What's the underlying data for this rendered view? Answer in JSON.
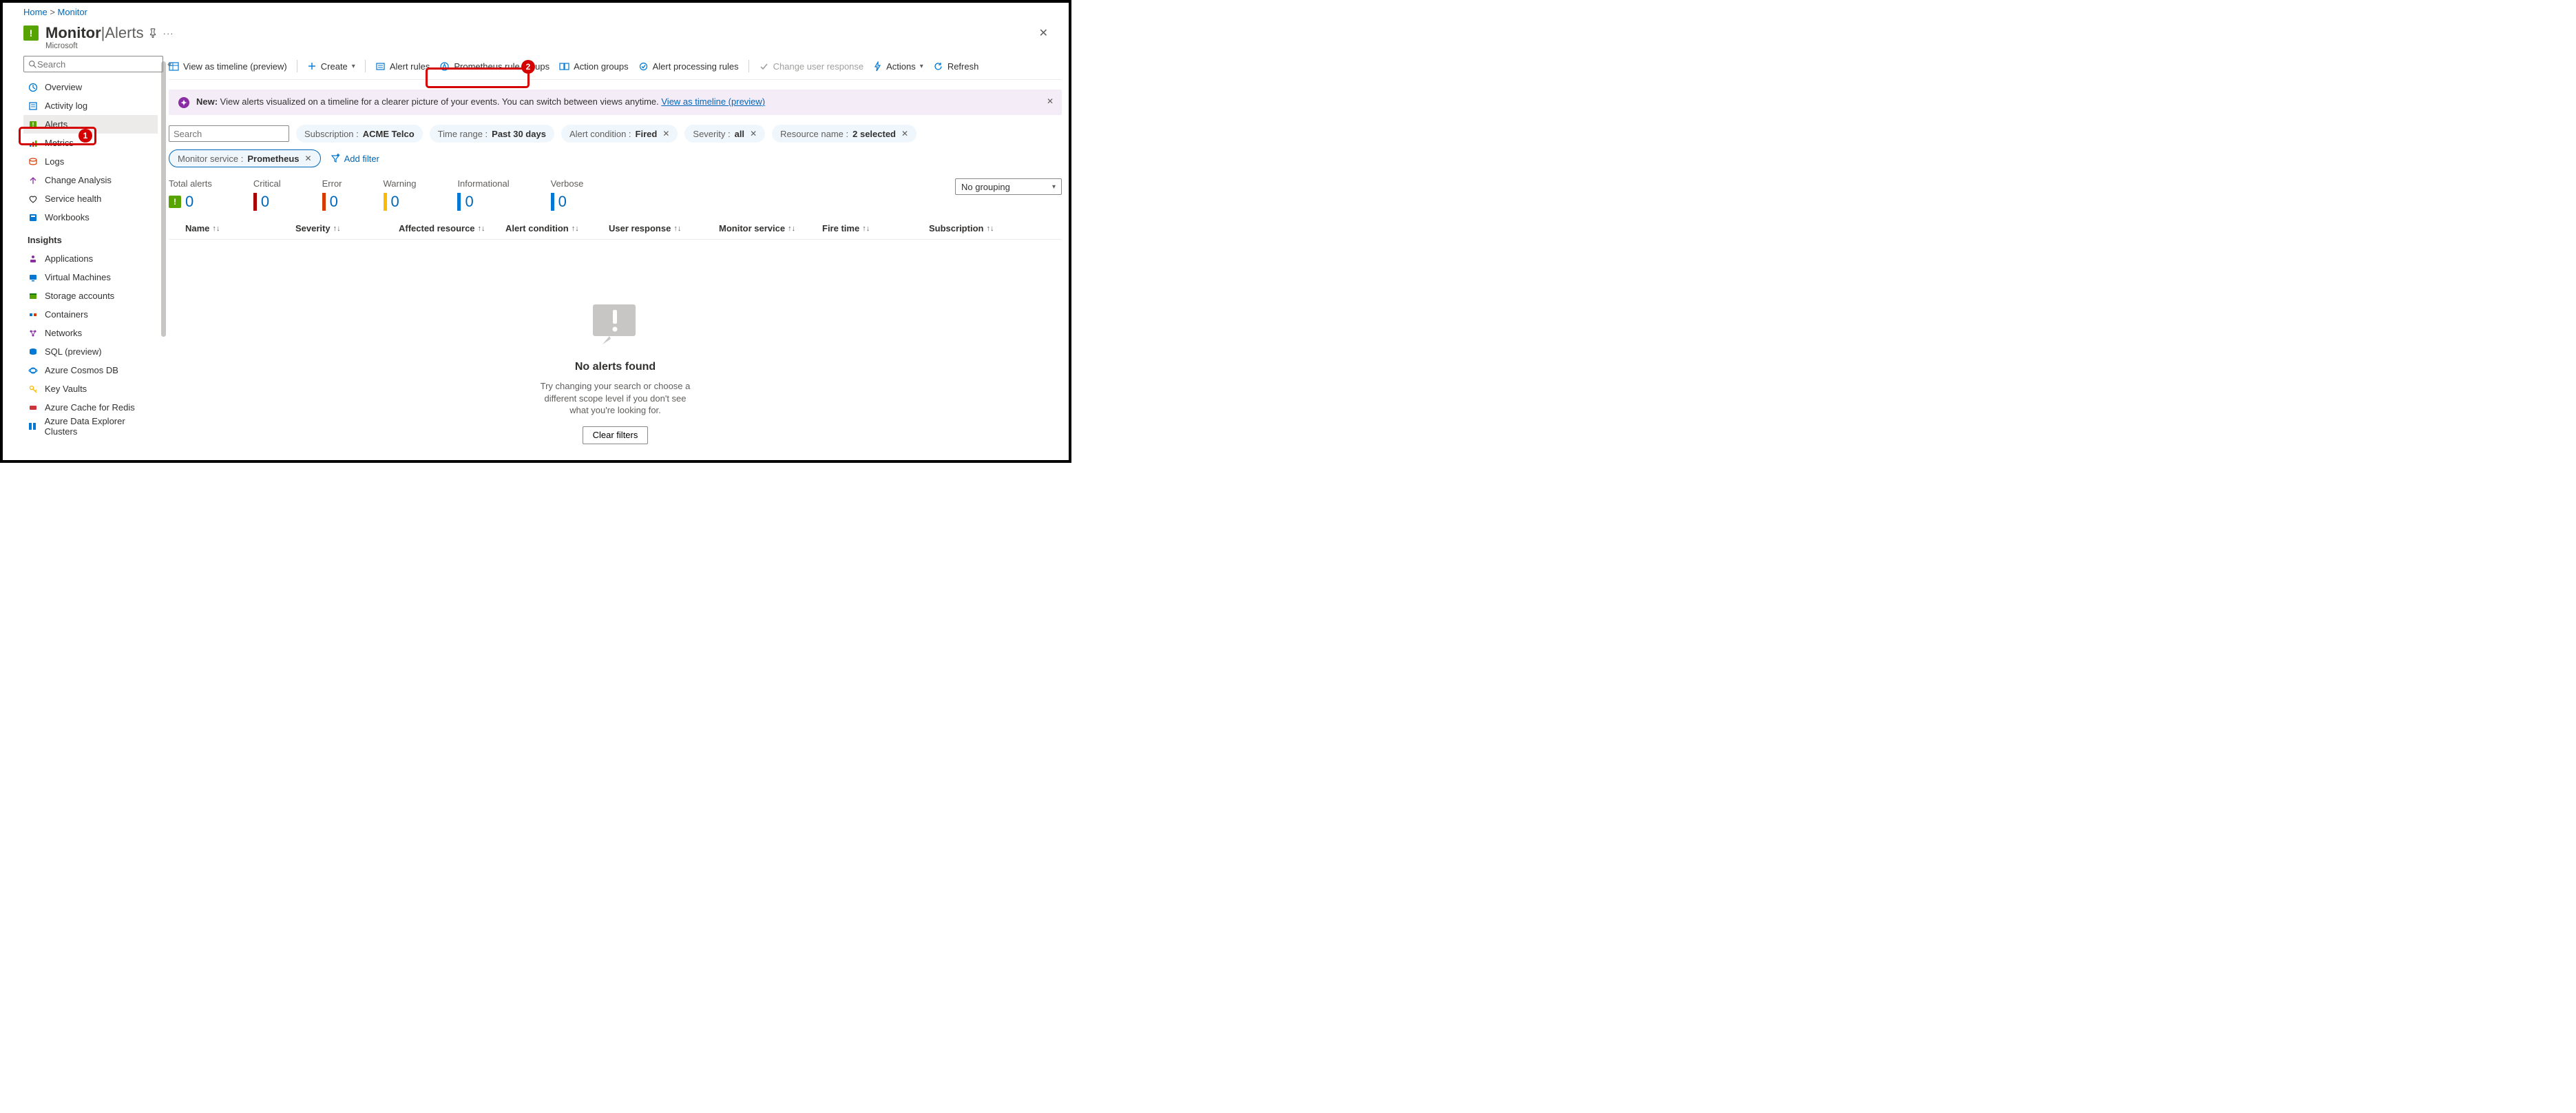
{
  "breadcrumb": {
    "home": "Home",
    "monitor": "Monitor"
  },
  "header": {
    "title_main": "Monitor",
    "title_sep": " | ",
    "title_sub": "Alerts",
    "subtitle": "Microsoft"
  },
  "sidebar": {
    "search": {
      "placeholder": "Search"
    },
    "items": [
      {
        "label": "Overview"
      },
      {
        "label": "Activity log"
      },
      {
        "label": "Alerts"
      },
      {
        "label": "Metrics"
      },
      {
        "label": "Logs"
      },
      {
        "label": "Change Analysis"
      },
      {
        "label": "Service health"
      },
      {
        "label": "Workbooks"
      }
    ],
    "insights_head": "Insights",
    "insights": [
      {
        "label": "Applications"
      },
      {
        "label": "Virtual Machines"
      },
      {
        "label": "Storage accounts"
      },
      {
        "label": "Containers"
      },
      {
        "label": "Networks"
      },
      {
        "label": "SQL (preview)"
      },
      {
        "label": "Azure Cosmos DB"
      },
      {
        "label": "Key Vaults"
      },
      {
        "label": "Azure Cache for Redis"
      },
      {
        "label": "Azure Data Explorer Clusters"
      }
    ]
  },
  "toolbar": {
    "view_timeline": "View as timeline (preview)",
    "create": "Create",
    "alert_rules": "Alert rules",
    "prometheus": "Prometheus rule groups",
    "action_groups": "Action groups",
    "processing": "Alert processing rules",
    "change_resp": "Change user response",
    "actions": "Actions",
    "refresh": "Refresh"
  },
  "banner": {
    "new": "New:",
    "text": " View alerts visualized on a timeline for a clearer picture of your events. You can switch between views anytime. ",
    "link": "View as timeline (preview)"
  },
  "search2": {
    "placeholder": "Search"
  },
  "filters": [
    {
      "k": "Subscription : ",
      "v": "ACME Telco",
      "x": false
    },
    {
      "k": "Time range : ",
      "v": "Past 30 days",
      "x": false
    },
    {
      "k": "Alert condition : ",
      "v": "Fired",
      "x": true
    },
    {
      "k": "Severity : ",
      "v": "all",
      "x": true
    },
    {
      "k": "Resource name : ",
      "v": "2 selected",
      "x": true
    },
    {
      "k": "Monitor service : ",
      "v": "Prometheus",
      "x": true,
      "selected": true
    }
  ],
  "add_filter": "Add filter",
  "metrics": [
    {
      "label": "Total alerts",
      "val": "0",
      "icon": true
    },
    {
      "label": "Critical",
      "val": "0",
      "color": "#a80000"
    },
    {
      "label": "Error",
      "val": "0",
      "color": "#d83b01"
    },
    {
      "label": "Warning",
      "val": "0",
      "color": "#ffb900"
    },
    {
      "label": "Informational",
      "val": "0",
      "color": "#0078d4"
    },
    {
      "label": "Verbose",
      "val": "0",
      "color": "#0078d4"
    }
  ],
  "grouping": "No grouping",
  "columns": [
    {
      "label": "Name",
      "w": 160
    },
    {
      "label": "Severity",
      "w": 150
    },
    {
      "label": "Affected resource",
      "w": 155
    },
    {
      "label": "Alert condition",
      "w": 150
    },
    {
      "label": "User response",
      "w": 160
    },
    {
      "label": "Monitor service",
      "w": 150
    },
    {
      "label": "Fire time",
      "w": 155
    },
    {
      "label": "Subscription",
      "w": 120
    }
  ],
  "empty": {
    "title": "No alerts found",
    "sub": "Try changing your search or choose a different scope level if you don't see what you're looking for.",
    "btn": "Clear filters"
  },
  "annotations": {
    "n1": "1",
    "n2": "2"
  }
}
